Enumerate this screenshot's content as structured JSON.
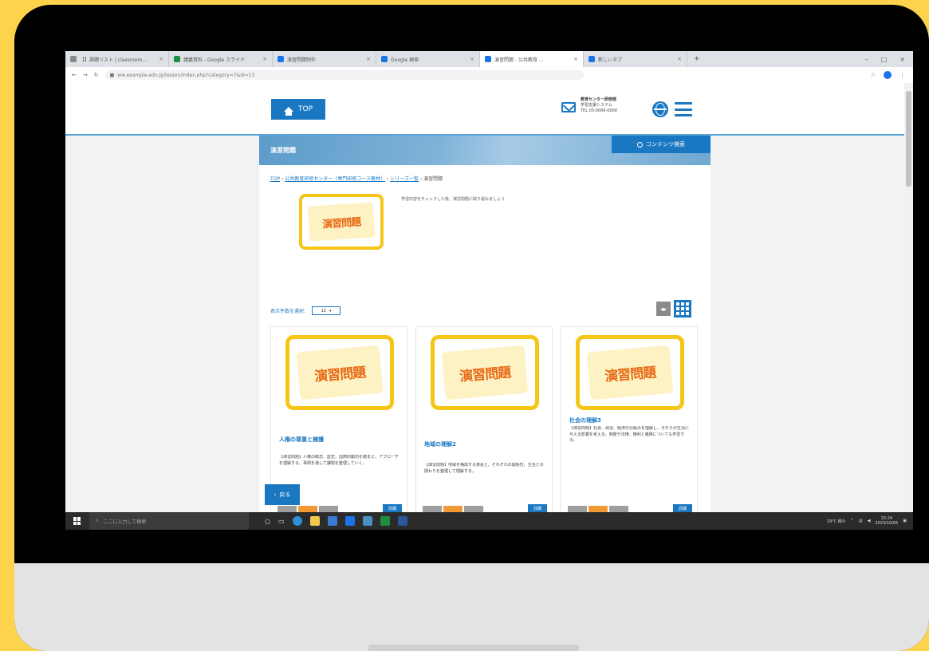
{
  "browser": {
    "tabs": [
      {
        "label": "【】課題リスト | classroom...",
        "active": false,
        "color": "#888888"
      },
      {
        "label": "講義資料 - Google スライド",
        "active": false,
        "color": "#1e8e3e"
      },
      {
        "label": "演習問題制作",
        "active": false,
        "color": "#1a73e8"
      },
      {
        "label": "Google 検索",
        "active": false,
        "color": "#1a73e8"
      },
      {
        "label": "演習問題 - 公共教育 ...",
        "active": true,
        "color": "#1a73e8"
      },
      {
        "label": "新しいタブ",
        "active": false,
        "color": "#1a73e8"
      }
    ],
    "url": "ww.example-edu.jp/lesson/index.php?category=7&id=13",
    "window_controls": [
      "–",
      "□",
      "×"
    ]
  },
  "header": {
    "top_button": "TOP",
    "org_lines": [
      "教育センター研修部",
      "学習支援システム",
      "TEL 03-0000-0000"
    ]
  },
  "banner": {
    "title": "演習問題",
    "search_button": "コンテンツ検索"
  },
  "breadcrumb": {
    "home": "TOP",
    "level1": "公共教育研修センター（専門研修コース教材）",
    "level2": "シリーズ一覧",
    "current": "演習問題"
  },
  "hero": {
    "image_text": "演習問題",
    "description": "学習内容をチェックした後、演習問題に取り組みましょう"
  },
  "list_controls": {
    "count_label": "表示件数を選択：",
    "count_value": "12",
    "list_view_icon": "list-icon",
    "grid_view_icon": "grid-icon"
  },
  "cards": [
    {
      "image_text": "演習問題",
      "title": "人権の尊重と擁護",
      "description": "【演習問題】人権の概念、歴史、国際的動向を踏まえ、アプローチを理解する。事例を通して課題を整理していく。",
      "more": "詳細"
    },
    {
      "image_text": "演習問題",
      "title": "地域の理解2",
      "description": "【演習問題】地域を構成する要素と、それぞれの関係性、生活との関わりを整理して理解する。",
      "more": "詳細"
    },
    {
      "image_text": "演習問題",
      "title": "社会の理解3",
      "description": "【演習問題】社会、政治、経済の仕組みを理解し、それらが生活に与える影響を考える。制度や法律、権利と義務についても学習する。",
      "more": "詳細"
    }
  ],
  "back_button": "戻る",
  "tag_colors": [
    "#9e9e9e",
    "#f19a35",
    "#9e9e9e"
  ],
  "taskbar": {
    "search_placeholder": "ここに入力して検索",
    "weather": "19°C 晴れ",
    "time": "15:24",
    "date": "2023/10/05"
  }
}
